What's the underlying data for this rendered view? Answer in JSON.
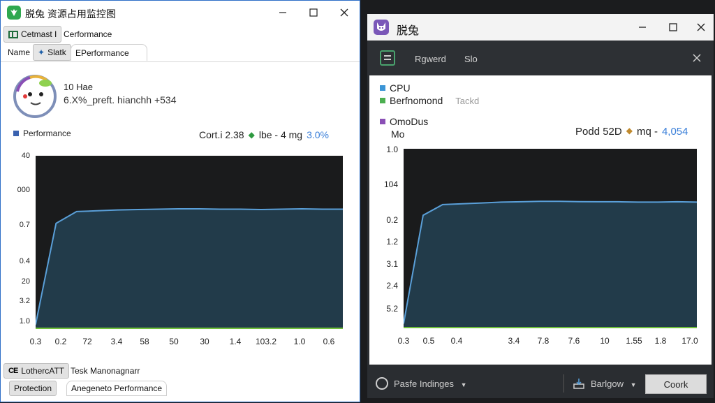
{
  "left_window": {
    "title": "脱兔 资源占用监控图",
    "tabs_row1": [
      "Cetmast I",
      "Cerformance"
    ],
    "tabs_row2": [
      "Name",
      "Slatk",
      "EPerformance"
    ],
    "profile": {
      "name": "10 Hae",
      "subtitle": "6.X%_preft. hianchh  +534"
    },
    "legend": "Performance",
    "stats": {
      "left": "Cort.i 2.38",
      "mid": "lbe - 4 mg",
      "right": "3.0%"
    },
    "bottom_tabs_row1": [
      "LothercATT",
      "Tesk Manonagnarr"
    ],
    "bottom_tabs_row2": [
      "Protection",
      "Anegeneto Performance"
    ],
    "colors": {
      "accent": "#2fa84f",
      "legend": "#3a62b0",
      "line": "#5a9fd8"
    }
  },
  "right_window": {
    "title": "脱兔",
    "header": {
      "item1": "Rgwerd",
      "item2": "Slo"
    },
    "legend": [
      {
        "label": "CPU",
        "color": "#3b95d6"
      },
      {
        "label": "Berfnomond",
        "color": "#4caf50",
        "extra": "Tackd"
      },
      {
        "label": "OmoDus",
        "color": "#8a4fb5"
      },
      {
        "label": "Mo",
        "color": "#4caf50"
      }
    ],
    "stats": {
      "left": "Podd 52D",
      "mid": "mq -",
      "right": "4,054"
    },
    "footer": {
      "left": "Pasfe Indinges",
      "mid": "Barlgow",
      "button": "Coork"
    }
  },
  "chart_data": [
    {
      "type": "area",
      "title": "",
      "y_ticks": [
        "40",
        "000",
        "0.7",
        "0.4",
        "20",
        "3.2",
        "1.0"
      ],
      "x_ticks": [
        "0.3",
        "0.2",
        "72",
        "3.4",
        "58",
        "50",
        "30",
        "1.4",
        "103.2",
        "1.0",
        "0.6"
      ],
      "series": [
        {
          "name": "Performance",
          "values": [
            0.02,
            0.66,
            0.735,
            0.74,
            0.745,
            0.748,
            0.75,
            0.752,
            0.752,
            0.75,
            0.75,
            0.748,
            0.75,
            0.752,
            0.75,
            0.75
          ]
        }
      ],
      "ylim": [
        0,
        1
      ],
      "grid": false
    },
    {
      "type": "area",
      "title": "",
      "y_ticks": [
        "1.0",
        "104",
        "0.2",
        "1.2",
        "3.1",
        "2.4",
        "5.2"
      ],
      "x_ticks": [
        "0.3",
        "0.5",
        "0.4",
        "3.4",
        "7.8",
        "7.6",
        "10",
        "1.55",
        "1.8",
        "17.0"
      ],
      "series": [
        {
          "name": "CPU",
          "values": [
            0.02,
            0.68,
            0.745,
            0.75,
            0.755,
            0.76,
            0.762,
            0.765,
            0.765,
            0.763,
            0.762,
            0.762,
            0.76,
            0.76,
            0.762,
            0.76
          ]
        }
      ],
      "ylim": [
        0,
        1
      ],
      "grid": false
    }
  ]
}
